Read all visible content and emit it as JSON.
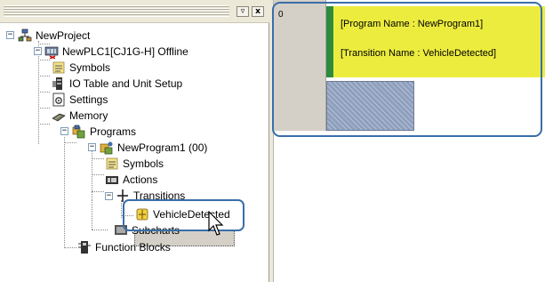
{
  "tree": {
    "nodes": {
      "project": "NewProject",
      "plc": "NewPLC1[CJ1G-H] Offline",
      "symbols": "Symbols",
      "io_table": "IO Table and Unit Setup",
      "settings": "Settings",
      "memory": "Memory",
      "programs": "Programs",
      "program1": "NewProgram1 (00)",
      "prog_symbols": "Symbols",
      "actions": "Actions",
      "transitions": "Transitions",
      "vehicle": "VehicleDetected",
      "subcharts": "Subcharts",
      "function_blocks": "Function Blocks"
    },
    "buttons": {
      "restore": "▿",
      "close": "x"
    }
  },
  "editor": {
    "row_number": "0",
    "program_name_comment": "[Program Name : NewProgram1]",
    "transition_name_comment": "[Transition Name : VehicleDetected]"
  },
  "colors": {
    "accent_highlight": "#3a6ea8",
    "comment_bg": "#ecec3f",
    "step_bar": "#2e8b3c",
    "step_block": "#8e9fbd"
  },
  "icons": {
    "project": "network-icon",
    "plc": "plc-icon",
    "symbols": "symbols-icon",
    "io_table": "io-table-icon",
    "settings": "settings-icon",
    "memory": "memory-icon",
    "programs": "programs-icon",
    "program1": "program-icon",
    "actions": "actions-icon",
    "transitions": "transitions-icon",
    "vehicle": "transition-item-icon",
    "subcharts": "subcharts-icon",
    "function_blocks": "function-blocks-icon",
    "cursor": "mouse-pointer-icon"
  }
}
